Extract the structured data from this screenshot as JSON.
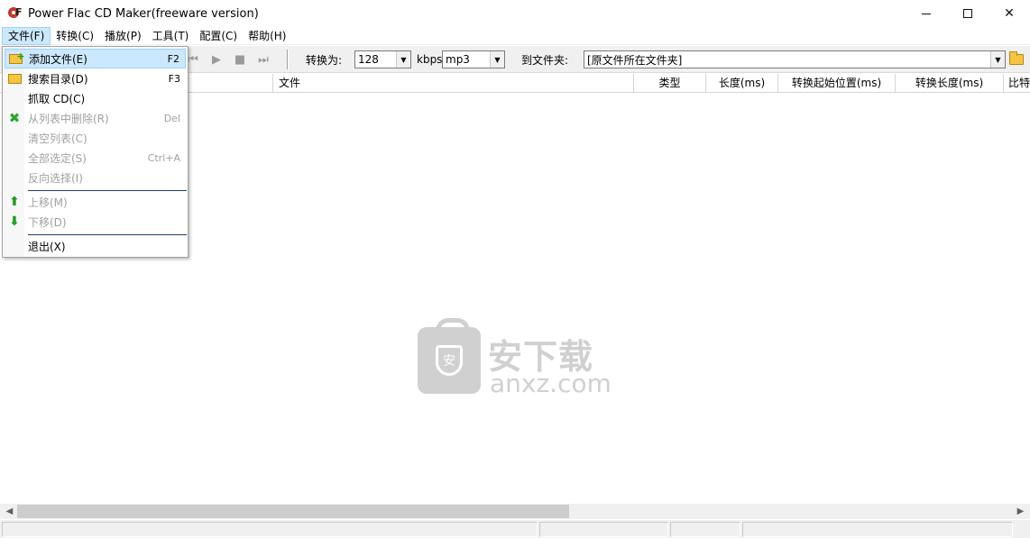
{
  "window": {
    "title": "Power Flac CD Maker(freeware version)"
  },
  "menubar": {
    "items": [
      "文件(F)",
      "转换(C)",
      "播放(P)",
      "工具(T)",
      "配置(C)",
      "帮助(H)"
    ]
  },
  "toolbar": {
    "convert_label": "转换为:",
    "bitrate_value": "128",
    "bitrate_unit": "kbps",
    "format_value": "mp3",
    "dest_label": "到文件夹:",
    "dest_value": "[原文件所在文件夹]"
  },
  "columns": [
    "文件",
    "类型",
    "长度(ms)",
    "转换起始位置(ms)",
    "转换长度(ms)",
    "比特"
  ],
  "file_menu": {
    "items": [
      {
        "label": "添加文件(E)",
        "shortcut": "F2",
        "icon": "add-folder-icon",
        "enabled": true,
        "highlighted": true
      },
      {
        "label": "搜索目录(D)",
        "shortcut": "F3",
        "icon": "open-folder-icon",
        "enabled": true
      },
      {
        "label": "抓取 CD(C)",
        "shortcut": "",
        "icon": "",
        "enabled": true
      },
      {
        "label": "从列表中删除(R)",
        "shortcut": "Del",
        "icon": "delete-x-icon",
        "enabled": false
      },
      {
        "label": "清空列表(C)",
        "shortcut": "",
        "icon": "",
        "enabled": false
      },
      {
        "label": "全部选定(S)",
        "shortcut": "Ctrl+A",
        "icon": "",
        "enabled": false
      },
      {
        "label": "反向选择(I)",
        "shortcut": "",
        "icon": "",
        "enabled": false
      },
      {
        "label": "上移(M)",
        "shortcut": "",
        "icon": "arrow-up-icon",
        "enabled": false
      },
      {
        "label": "下移(D)",
        "shortcut": "",
        "icon": "arrow-down-icon",
        "enabled": false
      },
      {
        "label": "退出(X)",
        "shortcut": "",
        "icon": "",
        "enabled": true
      }
    ]
  },
  "watermark": {
    "cn": "安下载",
    "en": "anxz.com",
    "shield": "安"
  },
  "colors": {
    "menu_highlight": "#cce8ff",
    "menu_highlight_border": "#99d1ff",
    "watermark": "#d0d0d0"
  }
}
